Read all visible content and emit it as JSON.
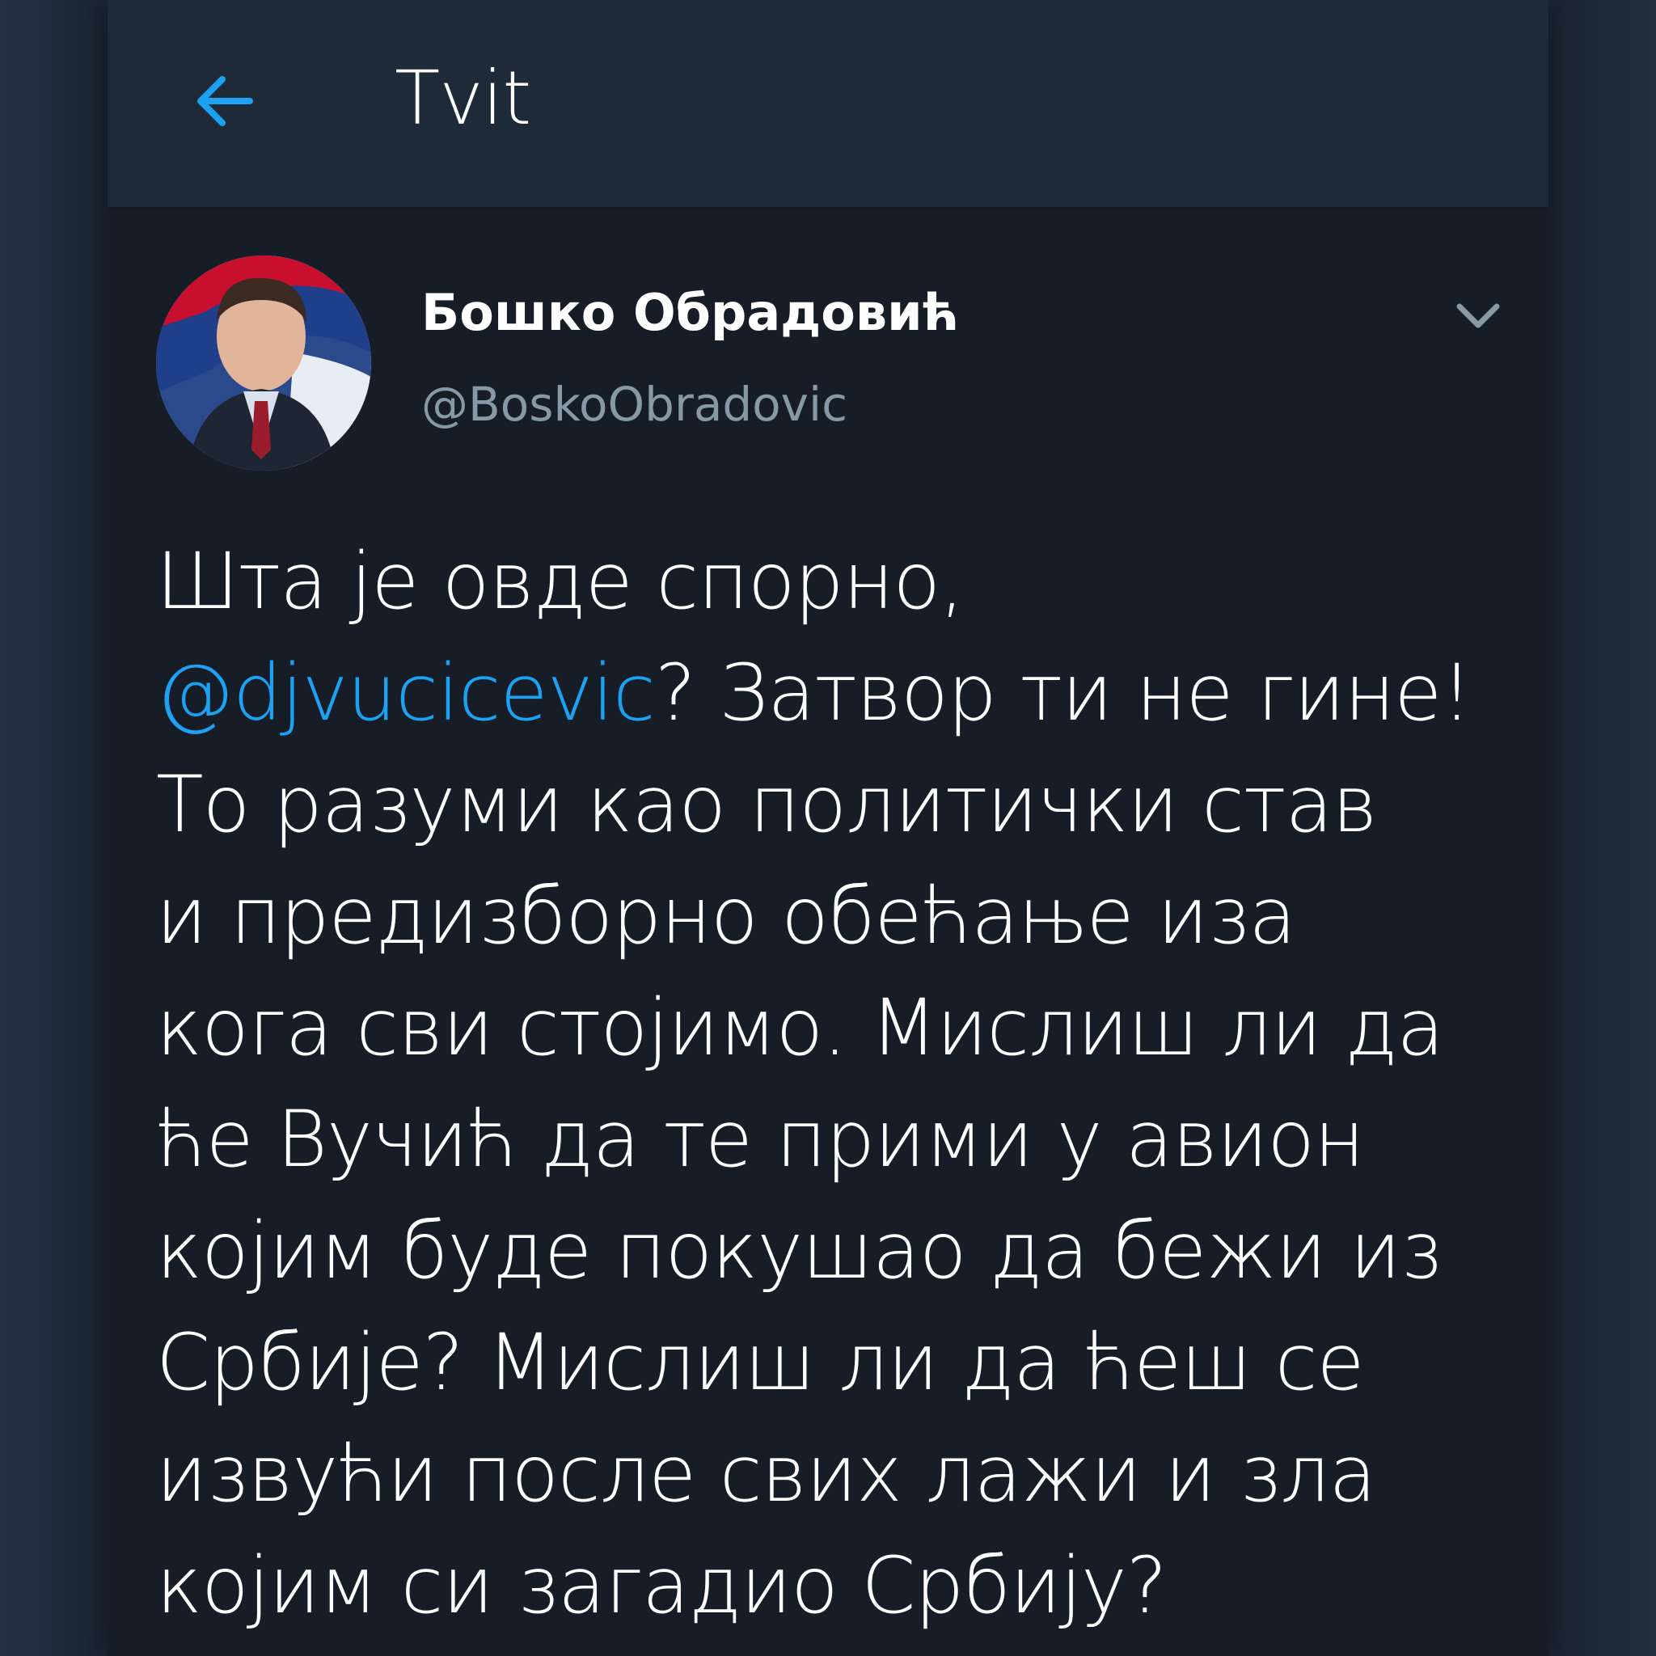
{
  "topbar": {
    "title": "Tvit",
    "back_icon": "arrow-left-icon"
  },
  "tweet": {
    "author_name": "Бошко Обрадовић",
    "author_handle": "@BoskoObradovic",
    "avatar_icon": "profile-photo",
    "menu_icon": "chevron-down-icon",
    "body": {
      "line1": "Шта је овде спорно,",
      "line2_mention": "@djvucicevic",
      "line2_rest": "? Затвор ти не гине!",
      "line3": "То разуми као политички став",
      "line4": "и предизборно обећање иза",
      "line5": "кога сви стојимо. Мислиш ли да",
      "line6": "ће Вучић да те прими у авион",
      "line7": "којим буде покушао да бежи из",
      "line8": "Србије? Мислиш ли да ћеш се",
      "line9": "извући после свих лажи и зла",
      "line10": "којим си загадио Србију?"
    }
  },
  "colors": {
    "accent": "#1da1f2",
    "background": "#161d27",
    "topbar": "#1f2a38",
    "secondary_text": "#8899a6"
  }
}
